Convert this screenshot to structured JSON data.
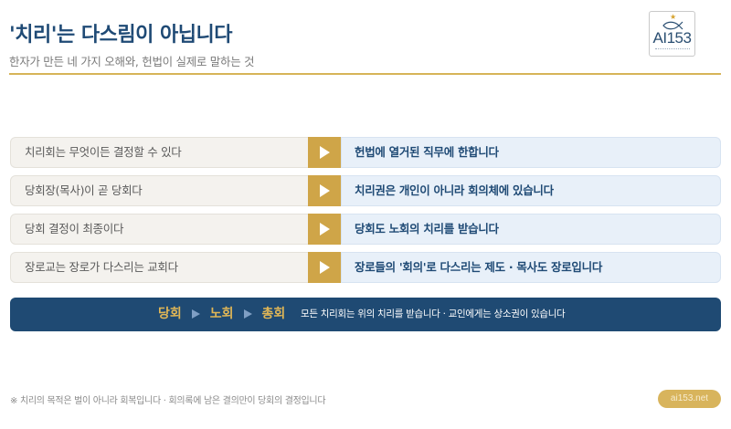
{
  "header": {
    "title": "'치리'는 다스림이 아닙니다",
    "subtitle": "한자가 만든 네 가지 오해와, 헌법이 실제로 말하는 것"
  },
  "logo": {
    "text": "AI153",
    "icon": "fish-icon"
  },
  "rows": [
    {
      "misconception": "치리회는 무엇이든 결정할 수 있다",
      "truth": "헌법에 열거된 직무에 한합니다"
    },
    {
      "misconception": "당회장(목사)이 곧 당회다",
      "truth": "치리권은 개인이 아니라 회의체에 있습니다"
    },
    {
      "misconception": "당회 결정이 최종이다",
      "truth": "당회도 노회의 치리를 받습니다"
    },
    {
      "misconception": "장로교는 장로가 다스리는 교회다",
      "truth": "장로들의 '회의'로 다스리는 제도 · 목사도 장로입니다"
    }
  ],
  "banner": {
    "chain": [
      "당회",
      "노회",
      "총회"
    ],
    "note": "모든 치리회는 위의 치리를 받습니다 · 교인에게는 상소권이 있습니다"
  },
  "footer": {
    "note": "※ 치리의 목적은 벌이 아니라 회복입니다 · 회의록에 남은 결의만이 당회의 결정입니다",
    "site": "ai153.net"
  },
  "colors": {
    "navy": "#1f4a73",
    "gold": "#cfa548",
    "light_blue": "#e8f0f9",
    "light_gray": "#f4f2ee"
  }
}
